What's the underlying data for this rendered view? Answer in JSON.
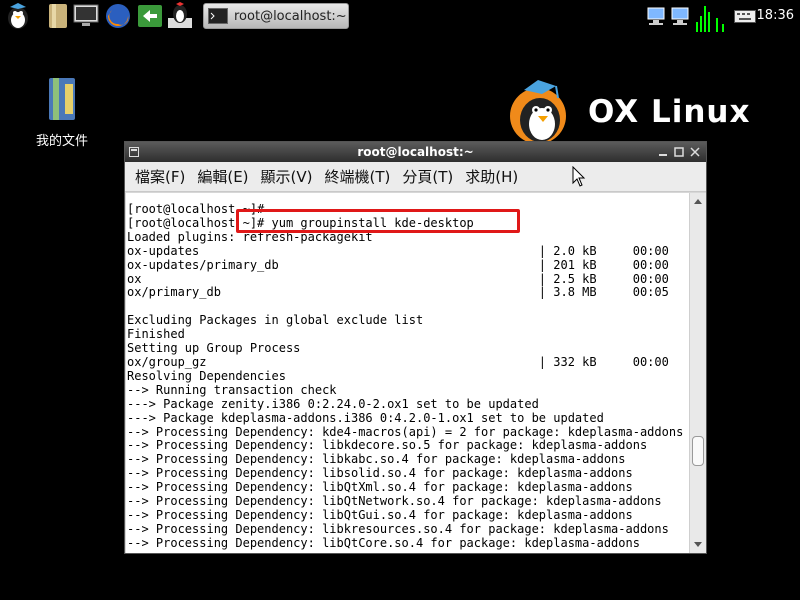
{
  "panel": {
    "launchers": [
      {
        "icon": "penguin-menu-icon"
      },
      {
        "icon": "file-manager-icon"
      },
      {
        "icon": "monitor-icon"
      },
      {
        "icon": "firefox-icon"
      },
      {
        "icon": "back-arrow-icon"
      },
      {
        "icon": "chess-penguin-icon"
      }
    ],
    "task_button": {
      "label": "root@localhost:~",
      "icon": "terminal-icon"
    },
    "tray": [
      "network-icon",
      "network-icon",
      "volume-bars-icon",
      "keyboard-icon"
    ],
    "clock": "18:36"
  },
  "desktop": {
    "icon_label": "我的文件",
    "icon": "folder-book-icon"
  },
  "logo": {
    "text": "OX Linux",
    "icon": "penguin-logo-icon"
  },
  "window": {
    "title": "root@localhost:~",
    "menu": [
      "檔案(F)",
      "編輯(E)",
      "顯示(V)",
      "終端機(T)",
      "分頁(T)",
      "求助(H)"
    ],
    "terminal_lines": [
      "[root@localhost ~]#",
      "[root@localhost ~]# yum groupinstall kde-desktop",
      "Loaded plugins: refresh-packagekit",
      "ox-updates                                               | 2.0 kB     00:00",
      "ox-updates/primary_db                                    | 201 kB     00:00",
      "ox                                                       | 2.5 kB     00:00",
      "ox/primary_db                                            | 3.8 MB     00:05",
      "",
      "Excluding Packages in global exclude list",
      "Finished",
      "Setting up Group Process",
      "ox/group_gz                                              | 332 kB     00:00",
      "Resolving Dependencies",
      "--> Running transaction check",
      "---> Package zenity.i386 0:2.24.0-2.ox1 set to be updated",
      "---> Package kdeplasma-addons.i386 0:4.2.0-1.ox1 set to be updated",
      "--> Processing Dependency: kde4-macros(api) = 2 for package: kdeplasma-addons",
      "--> Processing Dependency: libkdecore.so.5 for package: kdeplasma-addons",
      "--> Processing Dependency: libkabc.so.4 for package: kdeplasma-addons",
      "--> Processing Dependency: libsolid.so.4 for package: kdeplasma-addons",
      "--> Processing Dependency: libQtXml.so.4 for package: kdeplasma-addons",
      "--> Processing Dependency: libQtNetwork.so.4 for package: kdeplasma-addons",
      "--> Processing Dependency: libQtGui.so.4 for package: kdeplasma-addons",
      "--> Processing Dependency: libkresources.so.4 for package: kdeplasma-addons",
      "--> Processing Dependency: libQtCore.so.4 for package: kdeplasma-addons"
    ]
  },
  "colors": {
    "highlight": "#e01818",
    "desktop": "#000000"
  }
}
